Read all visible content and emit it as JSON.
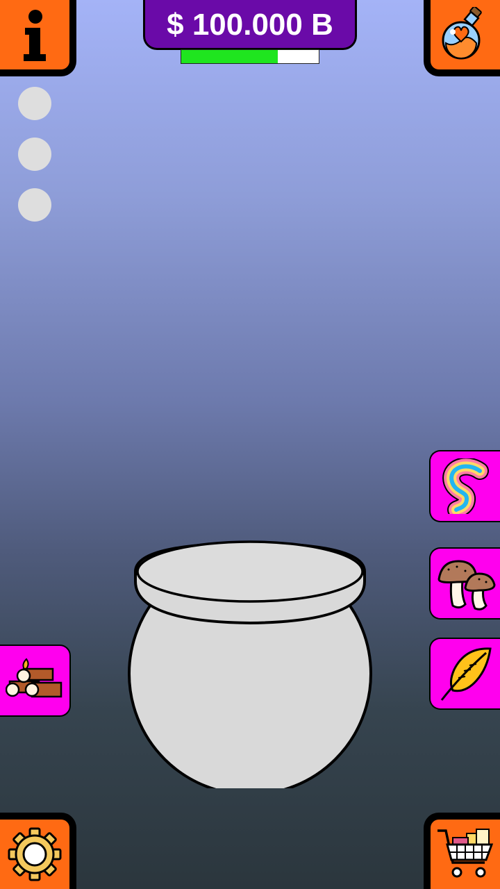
{
  "header": {
    "money": "$ 100.000 B",
    "progress_fraction": 0.7
  },
  "buttons": {
    "info_icon": "info-icon",
    "potion_icon": "potion-bottle-icon",
    "settings_icon": "gear-icon",
    "shop_icon": "shopping-cart-icon"
  },
  "indicators": {
    "count": 3,
    "color": "#dedede"
  },
  "ingredients": [
    {
      "name": "rainbow",
      "icon": "rainbow-icon"
    },
    {
      "name": "mushrooms",
      "icon": "mushroom-icon"
    },
    {
      "name": "feather",
      "icon": "feather-icon"
    }
  ],
  "fuel": {
    "name": "firewood",
    "icon": "firewood-icon"
  },
  "colors": {
    "corner_button": "#ff6a13",
    "money_panel": "#6a0aa8",
    "progress_fill": "#1fe51f",
    "ingredient_button": "#ff00ee",
    "cauldron": "#d9d9d9"
  }
}
